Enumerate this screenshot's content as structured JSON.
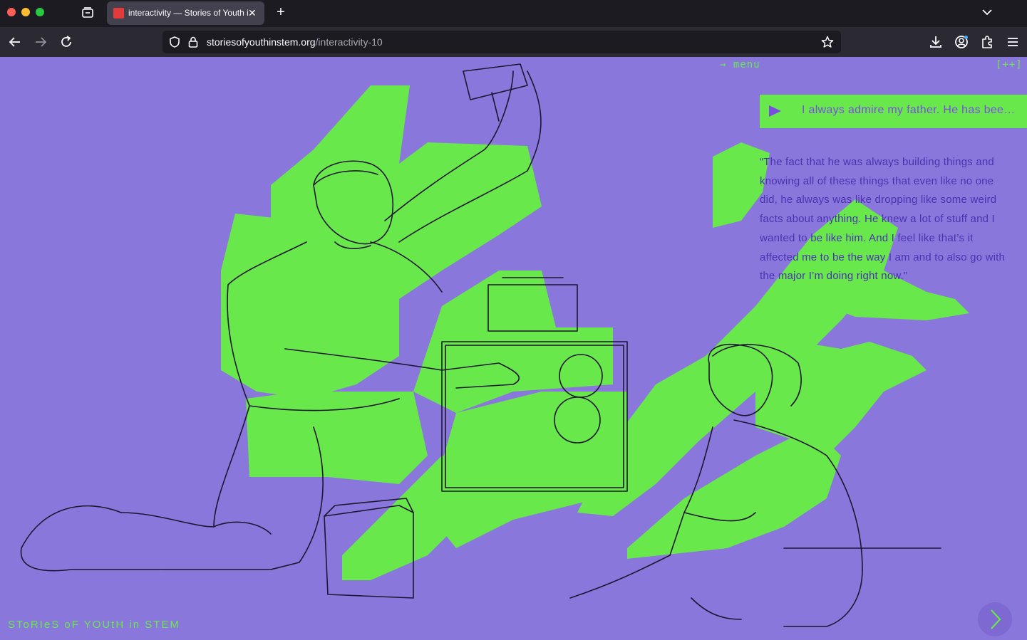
{
  "browser": {
    "tab_title": "interactivity — Stories of Youth in STEM",
    "tab_close": "✕",
    "new_tab": "+",
    "url_host": "storiesofyouthinstem.org",
    "url_path": "/interactivity-10"
  },
  "page": {
    "menu_label": "→ menu",
    "expand_label": "[++]",
    "audio_text": "I always admire my father. He has been always building things",
    "quote": "“The fact that he was always building things and knowing all of these things that even like no one did, he always was like dropping like some weird facts about anything. He knew a lot of stuff and I wanted to be like him. And I feel like that’s it affected me to be the way I am and to also go with the major I’m doing right now.”",
    "brand": "SToRIeS oF YOUtH in STEM"
  },
  "colors": {
    "background": "#8a77dc",
    "accent_green": "#68e84a",
    "accent_purple": "#7a4ee0",
    "sketch": "#1e1630"
  },
  "icons": [
    "back-icon",
    "forward-icon",
    "reload-icon",
    "shield-icon",
    "lock-icon",
    "star-icon",
    "download-icon",
    "account-icon",
    "extensions-icon",
    "menu-icon",
    "play-icon",
    "chevron-right-icon"
  ]
}
